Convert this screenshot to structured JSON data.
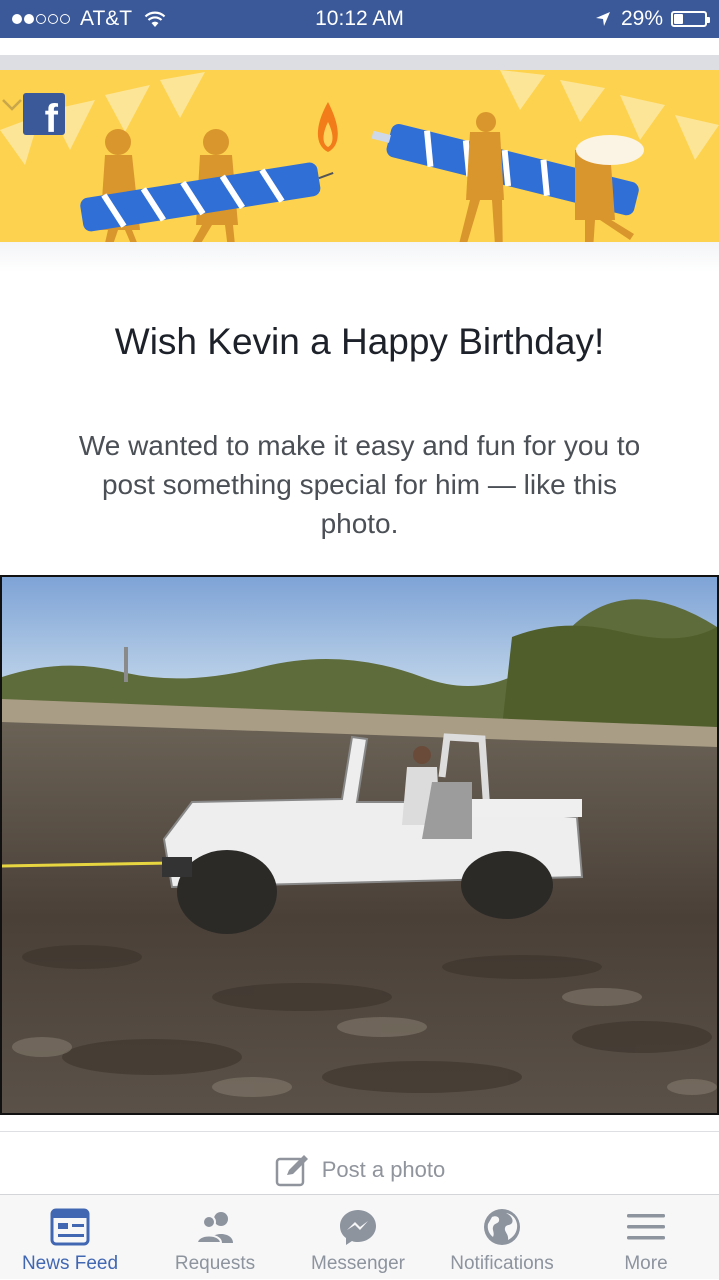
{
  "status_bar": {
    "carrier": "AT&T",
    "time": "10:12 AM",
    "battery": "29%",
    "battery_level": 0.29,
    "signal_bars_filled": 2,
    "signal_bars_total": 5
  },
  "banner": {
    "logo_letter": "f",
    "icons": [
      "facebook-logo-icon",
      "chevron-down-icon"
    ],
    "colors": {
      "background": "#fdd24e",
      "candle": "#2f6fd6",
      "figures": "#e2a23a"
    }
  },
  "card": {
    "headline": "Wish Kevin a Happy Birthday!",
    "body": "We wanted to make it easy and fun for you to post something special for him — like this photo."
  },
  "photo": {
    "description_icon": "jeep-in-mud-photo"
  },
  "action": {
    "post_photo_label": "Post a photo",
    "icon": "compose-icon"
  },
  "tab_bar": {
    "tabs": [
      {
        "label": "News Feed",
        "icon": "news-feed-icon",
        "active": true
      },
      {
        "label": "Requests",
        "icon": "requests-icon",
        "active": false
      },
      {
        "label": "Messenger",
        "icon": "messenger-icon",
        "active": false
      },
      {
        "label": "Notifications",
        "icon": "notifications-globe-icon",
        "active": false
      },
      {
        "label": "More",
        "icon": "menu-icon",
        "active": false
      }
    ],
    "active_color": "#4267b2",
    "inactive_color": "#8d949e"
  }
}
